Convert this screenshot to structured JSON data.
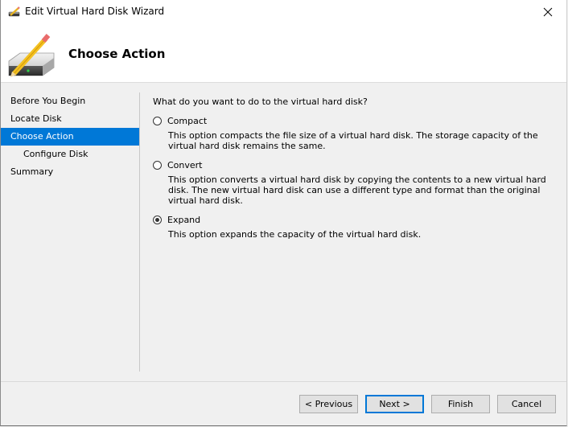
{
  "window": {
    "title": "Edit Virtual Hard Disk Wizard",
    "close_label": "Close"
  },
  "header": {
    "title": "Choose Action",
    "icon": "disk-pencil-icon"
  },
  "nav": {
    "items": [
      {
        "label": "Before You Begin",
        "active": false,
        "sub": false
      },
      {
        "label": "Locate Disk",
        "active": false,
        "sub": false
      },
      {
        "label": "Choose Action",
        "active": true,
        "sub": false
      },
      {
        "label": "Configure Disk",
        "active": false,
        "sub": true
      },
      {
        "label": "Summary",
        "active": false,
        "sub": false
      }
    ]
  },
  "content": {
    "question": "What do you want to do to the virtual hard disk?",
    "options": [
      {
        "label": "Compact",
        "selected": false,
        "description": "This option compacts the file size of a virtual hard disk. The storage capacity of the virtual hard disk remains the same."
      },
      {
        "label": "Convert",
        "selected": false,
        "description": "This option converts a virtual hard disk by copying the contents to a new virtual hard disk. The new virtual hard disk can use a different type and format than the original virtual hard disk."
      },
      {
        "label": "Expand",
        "selected": true,
        "description": "This option expands the capacity of the virtual hard disk."
      }
    ]
  },
  "buttons": {
    "previous": "< Previous",
    "next": "Next >",
    "finish": "Finish",
    "cancel": "Cancel"
  },
  "colors": {
    "accent": "#0078d7",
    "nav_active_text": "#ffffff"
  }
}
